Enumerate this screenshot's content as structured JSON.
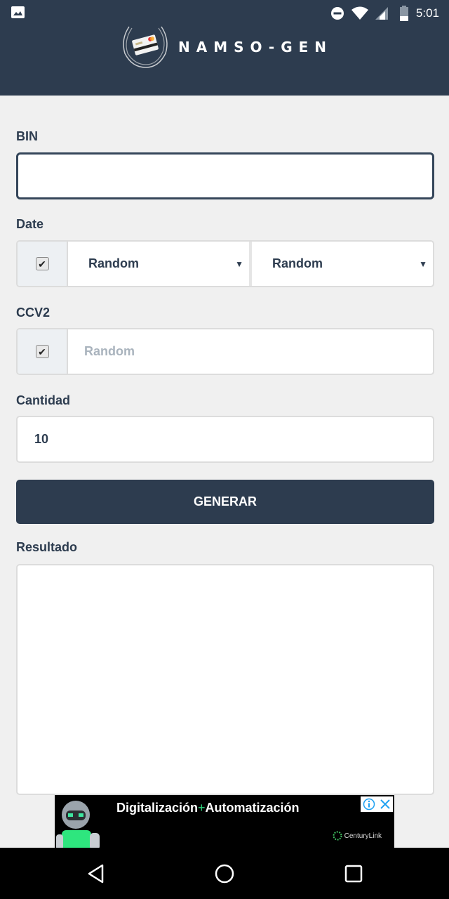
{
  "status_bar": {
    "time": "5:01",
    "icons": [
      "image-notification-icon",
      "do-not-disturb-icon",
      "wifi-icon",
      "cell-signal-icon",
      "battery-icon"
    ]
  },
  "header": {
    "app_name": "NAMSO-GEN",
    "logo_icon": "credit-card-laurel-icon"
  },
  "form": {
    "bin": {
      "label": "BIN",
      "value": "",
      "placeholder": ""
    },
    "date": {
      "label": "Date",
      "checked": true,
      "month_select": "Random",
      "year_select": "Random"
    },
    "ccv2": {
      "label": "CCV2",
      "checked": true,
      "placeholder": "Random",
      "value": ""
    },
    "cantidad": {
      "label": "Cantidad",
      "value": "10"
    },
    "generate_button": "GENERAR",
    "resultado": {
      "label": "Resultado",
      "value": ""
    }
  },
  "ad": {
    "headline_part1": "Digitalización",
    "plus": "+",
    "headline_part2": "Automatización",
    "brand": "CenturyLink"
  },
  "nav_bar": {
    "buttons": [
      "back",
      "home",
      "recents"
    ]
  }
}
